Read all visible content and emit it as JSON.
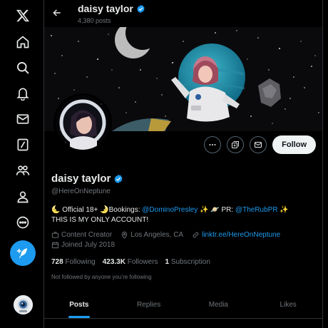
{
  "nav": {
    "items": [
      {
        "icon": "x-logo-icon"
      },
      {
        "icon": "home-icon"
      },
      {
        "icon": "search-icon"
      },
      {
        "icon": "bell-icon"
      },
      {
        "icon": "mail-icon"
      },
      {
        "icon": "grok-icon"
      },
      {
        "icon": "communities-icon"
      },
      {
        "icon": "profile-icon"
      },
      {
        "icon": "more-icon"
      }
    ],
    "post_icon": "feather-plus-icon"
  },
  "header": {
    "name": "daisy taylor",
    "post_count": "4,380 posts"
  },
  "profile": {
    "display_name": "daisy taylor",
    "handle": "@HereOnNeptune",
    "follow_label": "Follow",
    "bio": {
      "line1_prefix": "🌜 Official 18+ 🌛Bookings: ",
      "bookings_mention": "@DominoPresley",
      "line1_mid": " ✨ 🪐 PR: ",
      "pr_mention": "@TheRubPR",
      "line1_suffix": " ✨",
      "line2": "THIS IS MY ONLY ACCOUNT!"
    },
    "category": "Content Creator",
    "location": "Los Angeles, CA",
    "website": "linktr.ee/HereOnNeptune",
    "joined": "Joined July 2018",
    "following_count": "728",
    "following_label": "Following",
    "followers_count": "423.3K",
    "followers_label": "Followers",
    "subscription_count": "1",
    "subscription_label": "Subscription",
    "not_followed_text": "Not followed by anyone you’re following"
  },
  "tabs": [
    {
      "label": "Posts",
      "active": true
    },
    {
      "label": "Replies",
      "active": false
    },
    {
      "label": "Media",
      "active": false
    },
    {
      "label": "Likes",
      "active": false
    }
  ],
  "colors": {
    "accent": "#1d9bf0",
    "background": "#000000",
    "text": "#e7e9ea",
    "muted": "#71767b"
  }
}
